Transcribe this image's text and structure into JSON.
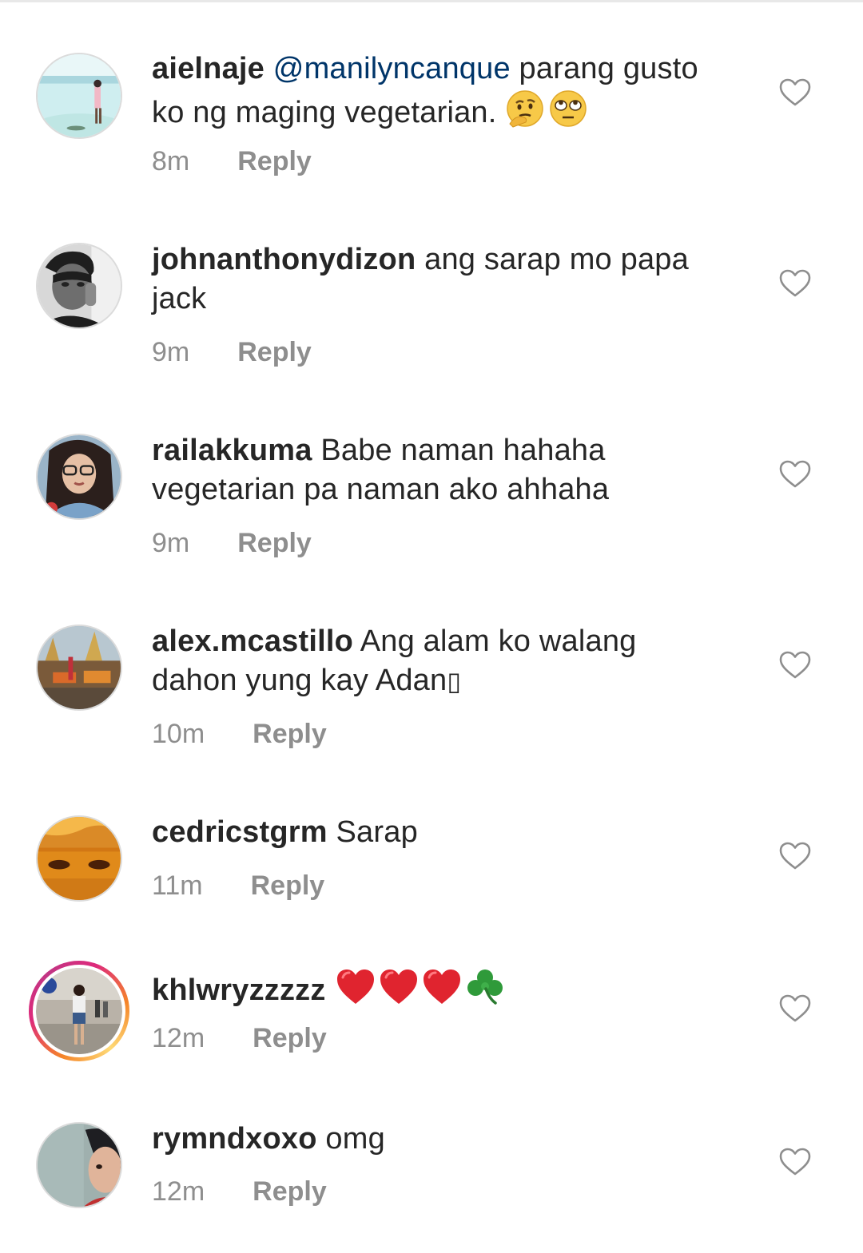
{
  "comments": [
    {
      "username": "aielnaje",
      "mention": "@manilyncanque",
      "text_line1": " parang gusto",
      "text_line2": "ko ng maging vegetarian. ",
      "emoji": [
        "thinking-face",
        "eye-roll-face"
      ],
      "time": "8m",
      "reply": "Reply"
    },
    {
      "username": "johnanthonydizon",
      "text_line1": " ang sarap mo papa",
      "text_line2": "jack",
      "time": "9m",
      "reply": "Reply"
    },
    {
      "username": "railakkuma",
      "text_line1": " Babe naman hahaha",
      "text_line2": "vegetarian pa naman ako ahhaha",
      "time": "9m",
      "reply": "Reply"
    },
    {
      "username": "alex.mcastillo",
      "text_line1": " Ang alam ko walang",
      "text_line2": "dahon yung kay Adan",
      "trailing_glyph": "▯",
      "time": "10m",
      "reply": "Reply"
    },
    {
      "username": "cedricstgrm",
      "text_line1": " Sarap",
      "time": "11m",
      "reply": "Reply"
    },
    {
      "username": "khlwryzzzzz",
      "emoji": [
        "red-heart",
        "red-heart",
        "red-heart",
        "shamrock"
      ],
      "time": "12m",
      "reply": "Reply"
    },
    {
      "username": "rymndxoxo",
      "text_line1": " omg",
      "time": "12m",
      "reply": "Reply"
    }
  ],
  "colors": {
    "username": "#262626",
    "mention": "#003569",
    "meta": "#8e8e8e",
    "heart_outline": "#8e8e8e"
  }
}
